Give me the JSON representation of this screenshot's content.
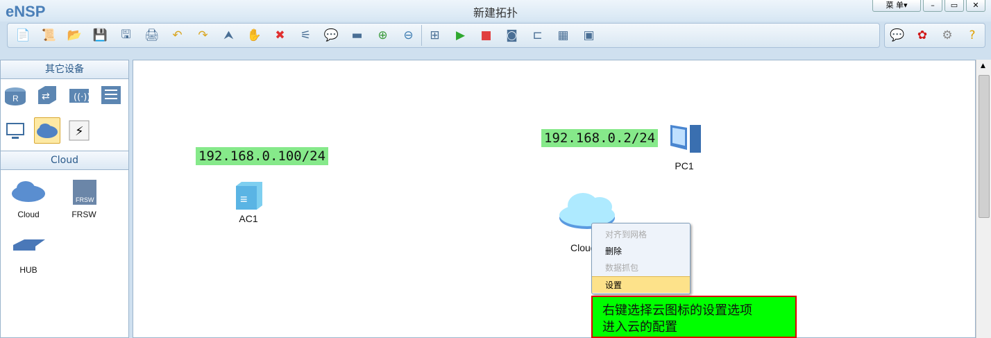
{
  "app": {
    "logo": "eNSP",
    "title": "新建拓扑",
    "menu_label": "菜 单▾",
    "min": "–",
    "max": "▭",
    "close": "✕"
  },
  "toolbar": [
    {
      "name": "new-topology",
      "glyph": "📄"
    },
    {
      "name": "new-example",
      "glyph": "📜"
    },
    {
      "name": "open",
      "glyph": "📂"
    },
    {
      "name": "save",
      "glyph": "💾"
    },
    {
      "name": "save-as",
      "glyph": "🖫"
    },
    {
      "name": "print",
      "glyph": "🖨"
    },
    {
      "name": "undo",
      "glyph": "↶"
    },
    {
      "name": "redo",
      "glyph": "↷"
    },
    {
      "name": "select",
      "glyph": "⮝"
    },
    {
      "name": "pan",
      "glyph": "✋"
    },
    {
      "name": "delete",
      "glyph": "✖"
    },
    {
      "name": "delete-link",
      "glyph": "⚟"
    },
    {
      "name": "text",
      "glyph": "💬"
    },
    {
      "name": "palette",
      "glyph": "▬"
    },
    {
      "name": "zoom-in",
      "glyph": "⊕"
    },
    {
      "name": "zoom-out",
      "glyph": "⊖"
    },
    {
      "name": "fit",
      "glyph": "⊞"
    },
    {
      "name": "start",
      "glyph": "▶"
    },
    {
      "name": "stop",
      "glyph": "■"
    },
    {
      "name": "capture",
      "glyph": "◙"
    },
    {
      "name": "topology",
      "glyph": "⊏"
    },
    {
      "name": "table",
      "glyph": "▦"
    },
    {
      "name": "terminal",
      "glyph": "▣"
    }
  ],
  "toolbar_right": [
    {
      "name": "chat",
      "glyph": "💬"
    },
    {
      "name": "huawei",
      "glyph": "✿"
    },
    {
      "name": "settings",
      "glyph": "⚙"
    },
    {
      "name": "help",
      "glyph": "?"
    }
  ],
  "sidebar": {
    "category_title": "其它设备",
    "devices_title": "Cloud",
    "categories": [
      "router",
      "switch",
      "wireless",
      "firewall",
      "pc",
      "cloud",
      "power"
    ],
    "devices": [
      {
        "label": "Cloud"
      },
      {
        "label": "FRSW"
      },
      {
        "label": "HUB"
      }
    ]
  },
  "canvas": {
    "ac1": {
      "label": "AC1",
      "ip": "192.168.0.100/24"
    },
    "pc1": {
      "label": "PC1",
      "ip": "192.168.0.2/24"
    },
    "cloud": {
      "label": "Cloud1"
    },
    "context_menu": [
      {
        "label": "对齐到网格",
        "disabled": true
      },
      {
        "label": "删除",
        "disabled": false
      },
      {
        "label": "数据抓包",
        "disabled": true
      },
      {
        "label": "设置",
        "disabled": false
      }
    ],
    "note": [
      "右键选择云图标的设置选项",
      "进入云的配置"
    ]
  },
  "colors": {
    "ip_label_bg": "#86e98a",
    "note_bg": "#00ff00",
    "note_border": "#e00000",
    "menu_highlight": "#fde28a"
  }
}
